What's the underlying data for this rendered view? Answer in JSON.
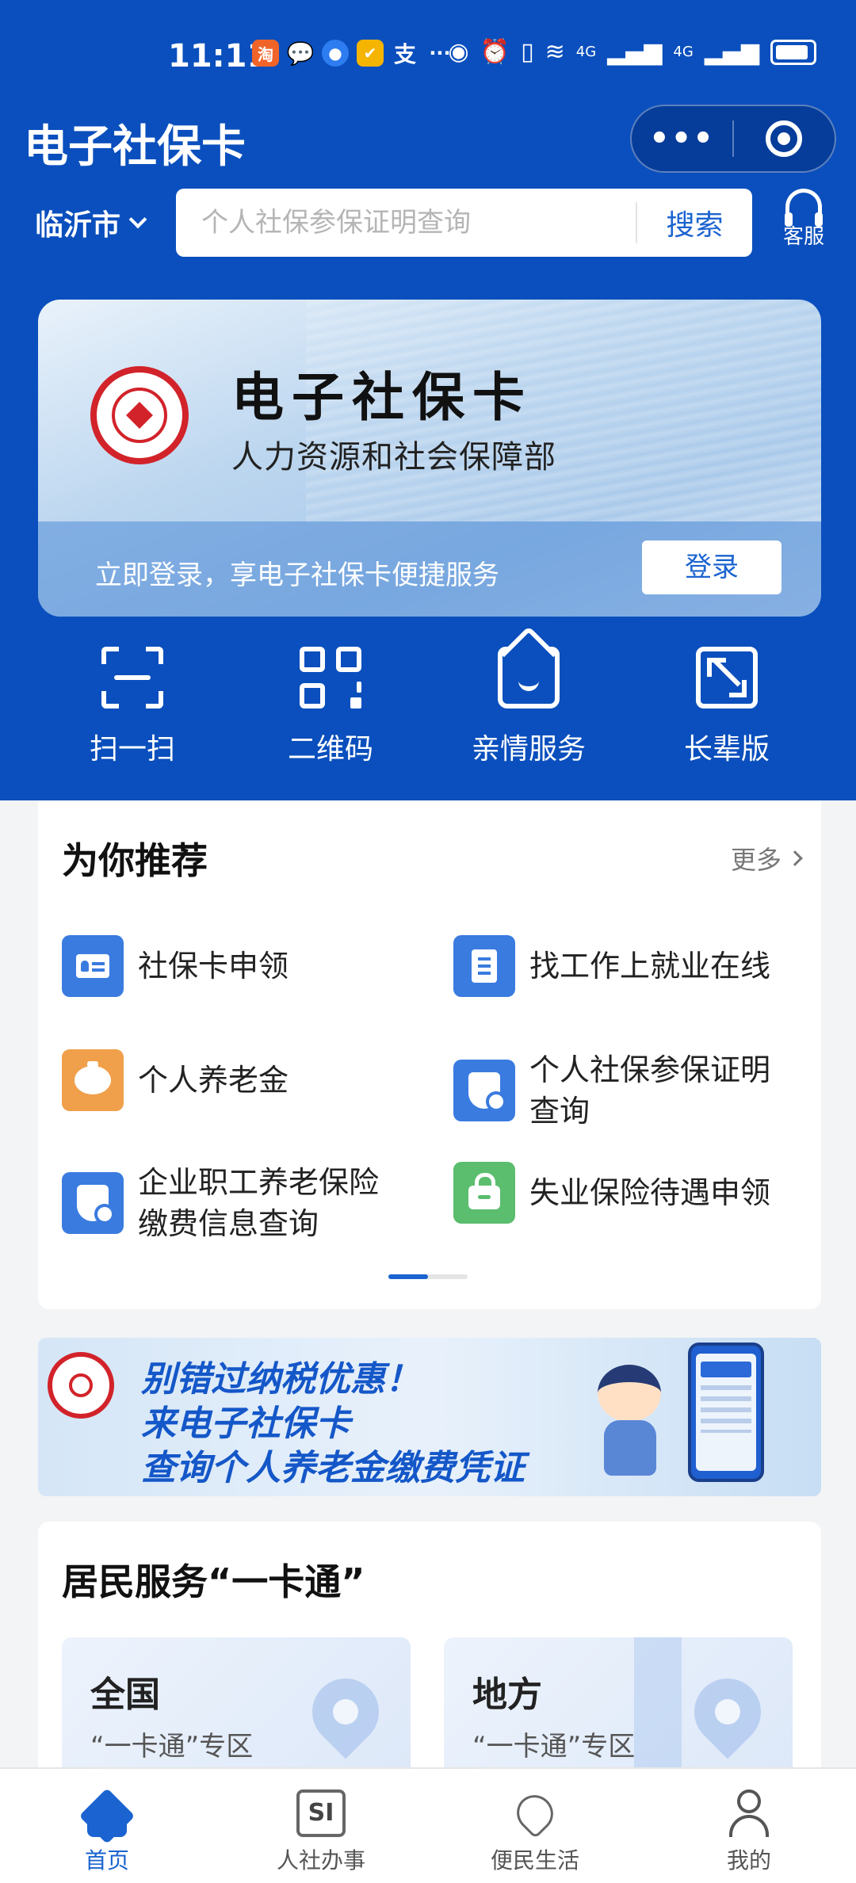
{
  "status_bar": {
    "time": "11:11",
    "app_badges": [
      "淘",
      "💬",
      "●",
      "✔",
      "支",
      "···"
    ],
    "right_icons": [
      "eye-icon",
      "alarm-icon",
      "vibrate-icon",
      "wifi-icon",
      "4g-signal-icon",
      "4g-signal-icon",
      "battery-icon"
    ],
    "signal_labels": [
      "4G",
      "4G"
    ]
  },
  "header": {
    "title": "电子社保卡",
    "capsule_more": "•••"
  },
  "search_bar": {
    "city": "临沂市",
    "placeholder": "个人社保参保证明查询",
    "button": "搜索",
    "service_label": "客服"
  },
  "card": {
    "title": "电子社保卡",
    "subtitle": "人力资源和社会保障部",
    "login_tip": "立即登录，享电子社保卡便捷服务",
    "login_button": "登录"
  },
  "quick_actions": [
    {
      "label": "扫一扫",
      "icon": "scan-icon"
    },
    {
      "label": "二维码",
      "icon": "qr-code-icon"
    },
    {
      "label": "亲情服务",
      "icon": "family-service-icon"
    },
    {
      "label": "长辈版",
      "icon": "elder-mode-icon"
    }
  ],
  "recommend": {
    "title": "为你推荐",
    "more": "更多",
    "items": [
      {
        "label": "社保卡申领",
        "icon": "id-card-icon",
        "color": "#3a7be0"
      },
      {
        "label": "找工作上就业在线",
        "icon": "document-icon",
        "color": "#3a7be0"
      },
      {
        "label": "个人养老金",
        "icon": "piggy-bank-icon",
        "color": "#f0a04b"
      },
      {
        "label": "个人社保参保证明查询",
        "icon": "shield-search-icon",
        "color": "#3a7be0"
      },
      {
        "label": "企业职工养老保险缴费信息查询",
        "icon": "shield-search-icon",
        "color": "#3a7be0"
      },
      {
        "label": "失业保险待遇申领",
        "icon": "lock-bag-icon",
        "color": "#5bbd6e"
      }
    ]
  },
  "banner": {
    "line1": "别错过纳税优惠！",
    "line2": "来电子社保卡",
    "line3": "查询个人养老金缴费凭证"
  },
  "resident": {
    "title": "居民服务“一卡通”",
    "cards": [
      {
        "title": "全国",
        "subtitle": "“一卡通”专区"
      },
      {
        "title": "地方",
        "subtitle": "“一卡通”专区"
      }
    ]
  },
  "tabbar": {
    "items": [
      {
        "label": "首页",
        "icon": "home-icon",
        "active": true
      },
      {
        "label": "人社办事",
        "icon": "si-icon",
        "active": false
      },
      {
        "label": "便民生活",
        "icon": "heart-hands-icon",
        "active": false
      },
      {
        "label": "我的",
        "icon": "user-icon",
        "active": false
      }
    ],
    "si_glyph": "SI"
  },
  "colors": {
    "brand_blue": "#0a4fbd",
    "accent_blue": "#1b63d0",
    "seal_red": "#d2232a",
    "orange": "#f0a04b",
    "green": "#5bbd6e"
  }
}
